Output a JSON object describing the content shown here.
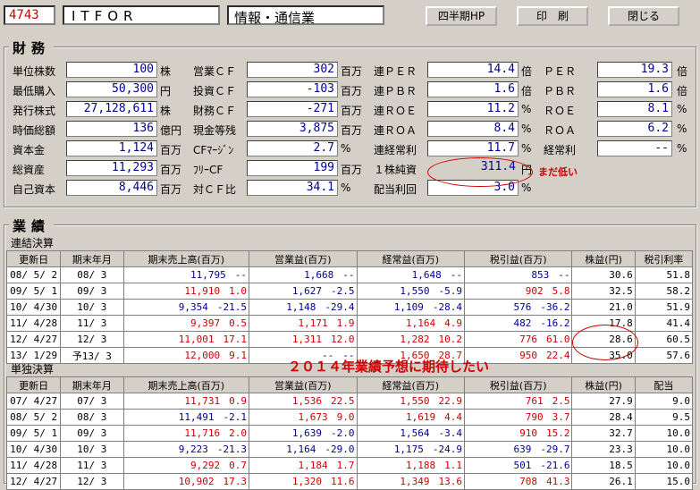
{
  "header": {
    "code": "4743",
    "name": "ITFOR",
    "industry": "情報・通信業",
    "btn_hp": "四半期HP",
    "btn_print": "印　刷",
    "btn_close": "閉じる"
  },
  "finance": {
    "title": "財務",
    "col1": [
      {
        "label": "単位株数",
        "value": "100",
        "unit": "株"
      },
      {
        "label": "最低購入",
        "value": "50,300",
        "unit": "円"
      },
      {
        "label": "発行株式",
        "value": "27,128,611",
        "unit": "株"
      },
      {
        "label": "時価総額",
        "value": "136",
        "unit": "億円"
      },
      {
        "label": "資本金",
        "value": "1,124",
        "unit": "百万"
      },
      {
        "label": "総資産",
        "value": "11,293",
        "unit": "百万"
      },
      {
        "label": "自己資本",
        "value": "8,446",
        "unit": "百万"
      }
    ],
    "col2": [
      {
        "label": "営業ＣＦ",
        "value": "302",
        "unit": "百万"
      },
      {
        "label": "投資ＣＦ",
        "value": "-103",
        "unit": "百万"
      },
      {
        "label": "財務ＣＦ",
        "value": "-271",
        "unit": "百万"
      },
      {
        "label": "現金等残",
        "value": "3,875",
        "unit": "百万"
      },
      {
        "label": "CFﾏｰｼﾞﾝ",
        "value": "2.7",
        "unit": "%"
      },
      {
        "label": "ﾌﾘｰCF",
        "value": "199",
        "unit": "百万"
      },
      {
        "label": "対ＣＦ比",
        "value": "34.1",
        "unit": "%"
      }
    ],
    "col3": [
      {
        "label": "連ＰＥＲ",
        "value": "14.4",
        "unit": "倍"
      },
      {
        "label": "連ＰＢＲ",
        "value": "1.6",
        "unit": "倍"
      },
      {
        "label": "連ＲＯＥ",
        "value": "11.2",
        "unit": "%"
      },
      {
        "label": "連ＲＯＡ",
        "value": "8.4",
        "unit": "%"
      },
      {
        "label": "連経常利",
        "value": "11.7",
        "unit": "%"
      },
      {
        "label": "１株純資",
        "value": "311.4",
        "unit": "円"
      },
      {
        "label": "配当利回",
        "value": "3.0",
        "unit": "%"
      }
    ],
    "col4": [
      {
        "label": "ＰＥＲ",
        "value": "19.3",
        "unit": "倍"
      },
      {
        "label": "ＰＢＲ",
        "value": "1.6",
        "unit": "倍"
      },
      {
        "label": "ＲＯＥ",
        "value": "8.1",
        "unit": "%"
      },
      {
        "label": "ＲＯＡ",
        "value": "6.2",
        "unit": "%"
      },
      {
        "label": "経常利",
        "value": "--",
        "unit": "%"
      }
    ],
    "note_low": "まだ低い"
  },
  "results": {
    "title": "業績",
    "consolidated_label": "連結決算",
    "headers": [
      "更新日",
      "期末年月",
      "期末売上高(百万)",
      "営業益(百万)",
      "経常益(百万)",
      "税引益(百万)",
      "株益(円)",
      "税引利率"
    ],
    "consolidated": [
      [
        "08/ 5/ 2",
        "08/ 3",
        "11,795",
        "--",
        "1,668",
        "--",
        "1,648",
        "--",
        "853",
        "--",
        "30.6",
        "51.8"
      ],
      [
        "09/ 5/ 1",
        "09/ 3",
        "11,910",
        "1.0",
        "1,627",
        "-2.5",
        "1,550",
        "-5.9",
        "902",
        "5.8",
        "32.5",
        "58.2"
      ],
      [
        "10/ 4/30",
        "10/ 3",
        "9,354",
        "-21.5",
        "1,148",
        "-29.4",
        "1,109",
        "-28.4",
        "576",
        "-36.2",
        "21.0",
        "51.9"
      ],
      [
        "11/ 4/28",
        "11/ 3",
        "9,397",
        "0.5",
        "1,171",
        "1.9",
        "1,164",
        "4.9",
        "482",
        "-16.2",
        "17.8",
        "41.4"
      ],
      [
        "12/ 4/27",
        "12/ 3",
        "11,001",
        "17.1",
        "1,311",
        "12.0",
        "1,282",
        "10.2",
        "776",
        "61.0",
        "28.6",
        "60.5"
      ],
      [
        "13/ 1/29",
        "予13/ 3",
        "12,000",
        "9.1",
        "--",
        "--",
        "1,650",
        "28.7",
        "950",
        "22.4",
        "35.0",
        "57.6"
      ]
    ],
    "forecast_note": "２０１４年業績予想に期待したい",
    "standalone_label": "単独決算",
    "headers2": [
      "更新日",
      "期末年月",
      "期末売上高(百万)",
      "営業益(百万)",
      "経常益(百万)",
      "税引益(百万)",
      "株益(円)",
      "配当"
    ],
    "standalone": [
      [
        "07/ 4/27",
        "07/ 3",
        "11,731",
        "0.9",
        "1,536",
        "22.5",
        "1,550",
        "22.9",
        "761",
        "2.5",
        "27.9",
        "9.0"
      ],
      [
        "08/ 5/ 2",
        "08/ 3",
        "11,491",
        "-2.1",
        "1,673",
        "9.0",
        "1,619",
        "4.4",
        "790",
        "3.7",
        "28.4",
        "9.5"
      ],
      [
        "09/ 5/ 1",
        "09/ 3",
        "11,716",
        "2.0",
        "1,639",
        "-2.0",
        "1,564",
        "-3.4",
        "910",
        "15.2",
        "32.7",
        "10.0"
      ],
      [
        "10/ 4/30",
        "10/ 3",
        "9,223",
        "-21.3",
        "1,164",
        "-29.0",
        "1,175",
        "-24.9",
        "639",
        "-29.7",
        "23.3",
        "10.0"
      ],
      [
        "11/ 4/28",
        "11/ 3",
        "9,292",
        "0.7",
        "1,184",
        "1.7",
        "1,188",
        "1.1",
        "501",
        "-21.6",
        "18.5",
        "10.0"
      ],
      [
        "12/ 4/27",
        "12/ 3",
        "10,902",
        "17.3",
        "1,320",
        "11.6",
        "1,349",
        "13.6",
        "708",
        "41.3",
        "26.1",
        "15.0"
      ]
    ]
  }
}
